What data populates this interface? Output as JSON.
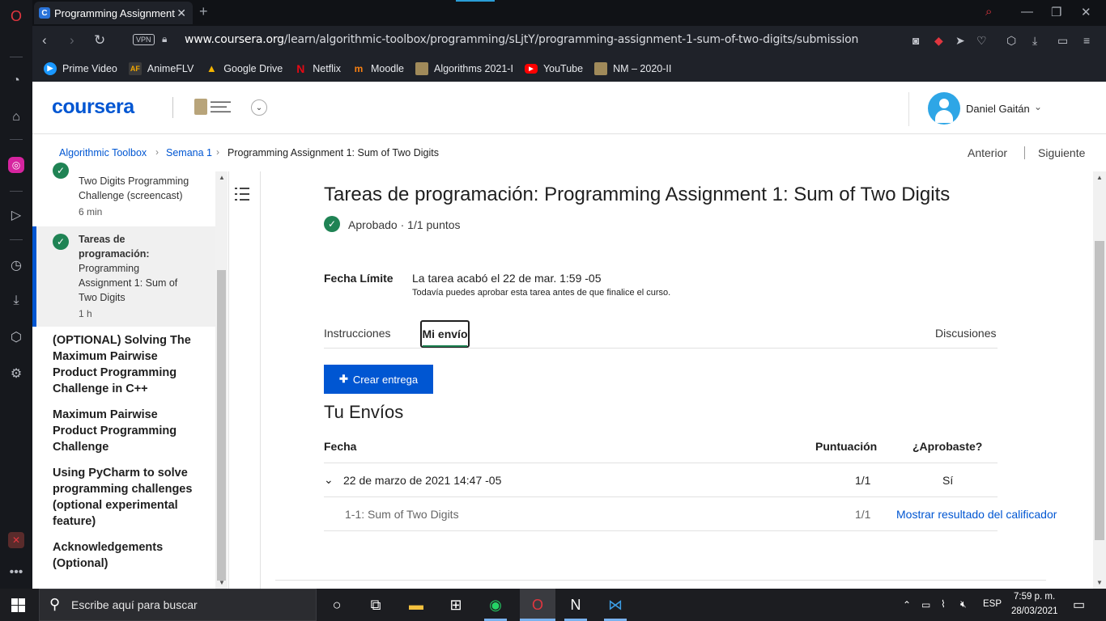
{
  "browser": {
    "tab_title": "Programming Assignment",
    "url_host": "www.coursera.org",
    "url_path": "/learn/algorithmic-toolbox/programming/sLjtY/programming-assignment-1-sum-of-two-digits/submission",
    "vpn_badge": "VPN",
    "bookmarks": [
      {
        "label": "Prime Video",
        "icon": "prime-video-icon",
        "color": "#1a98ff"
      },
      {
        "label": "AnimeFLV",
        "icon": "animeflv-icon",
        "color": "#3a3a3a"
      },
      {
        "label": "Google Drive",
        "icon": "google-drive-icon",
        "color": "#f4b400"
      },
      {
        "label": "Netflix",
        "icon": "netflix-icon",
        "color": "#e50914"
      },
      {
        "label": "Moodle",
        "icon": "moodle-icon",
        "color": "#f98012"
      },
      {
        "label": "Algorithms 2021-I",
        "icon": "unal-seal-icon",
        "color": "#a08a5a"
      },
      {
        "label": "YouTube",
        "icon": "youtube-icon",
        "color": "#ff0000"
      },
      {
        "label": "NM – 2020-II",
        "icon": "unal-seal-icon",
        "color": "#a08a5a"
      }
    ]
  },
  "header": {
    "logo": "coursera",
    "user_name": "Daniel Gaitán"
  },
  "breadcrumb": {
    "items": [
      "Algorithmic Toolbox",
      "Semana 1",
      "Programming Assignment 1: Sum of Two Digits"
    ],
    "prev": "Anterior",
    "next": "Siguiente"
  },
  "sidebar": {
    "top_item": {
      "lines": [
        "Two Digits Programming",
        "Challenge (screencast)"
      ],
      "meta": "6 min"
    },
    "active_item": {
      "lines": [
        "Tareas de",
        "programación:",
        "Programming",
        "Assignment 1: Sum of",
        "Two Digits"
      ],
      "meta": "1 h"
    },
    "sections": [
      {
        "lines": [
          "(OPTIONAL) Solving The",
          "Maximum Pairwise",
          "Product Programming",
          "Challenge in C++"
        ]
      },
      {
        "lines": [
          "Maximum Pairwise",
          "Product Programming",
          "Challenge"
        ]
      },
      {
        "lines": [
          "Using PyCharm to solve",
          "programming challenges",
          "(optional experimental",
          "feature)"
        ]
      },
      {
        "lines": [
          "Acknowledgements",
          "(Optional)"
        ]
      }
    ]
  },
  "main": {
    "title": "Tareas de programación: Programming Assignment 1: Sum of Two Digits",
    "status": "Aprobado · 1/1 puntos",
    "deadline_label": "Fecha Límite",
    "deadline_value": "La tarea acabó el 22 de mar. 1:59 -05",
    "deadline_note": "Todavía puedes aprobar esta tarea antes de que finalice el curso.",
    "tabs": [
      "Instrucciones",
      "Mi envío",
      "Discusiones"
    ],
    "create_button": "Crear entrega",
    "submissions_title": "Tu Envíos",
    "table": {
      "headers": [
        "Fecha",
        "Puntuación",
        "¿Aprobaste?"
      ],
      "row": {
        "date": "22 de marzo de 2021 14:47 -05",
        "score": "1/1",
        "passed": "Sí"
      },
      "subrow": {
        "name": "1-1: Sum of Two Digits",
        "score": "1/1",
        "link": "Mostrar resultado del calificador"
      }
    }
  },
  "taskbar": {
    "search_placeholder": "Escribe aquí para buscar",
    "lang": "ESP",
    "time": "7:59 p. m.",
    "date": "28/03/2021"
  }
}
